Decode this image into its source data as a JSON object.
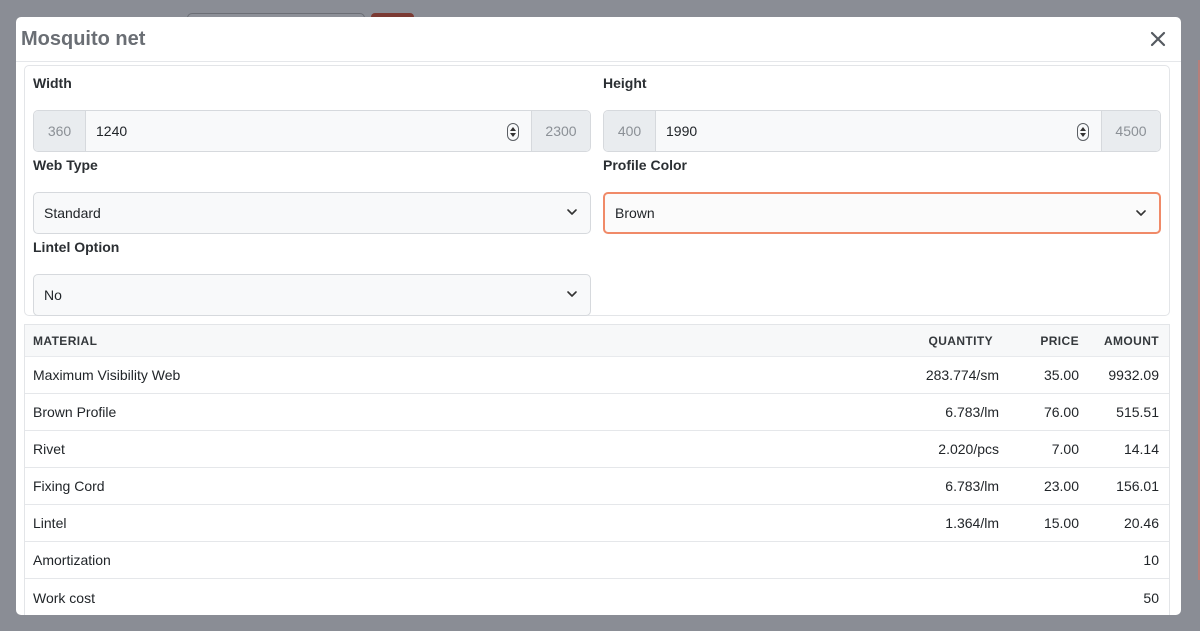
{
  "modal": {
    "title": "Mosquito net"
  },
  "form": {
    "width": {
      "label": "Width",
      "min": "360",
      "value": "1240",
      "max": "2300"
    },
    "height": {
      "label": "Height",
      "min": "400",
      "value": "1990",
      "max": "4500"
    },
    "web_type": {
      "label": "Web Type",
      "selected": "Standard"
    },
    "profile_color": {
      "label": "Profile Color",
      "selected": "Brown"
    },
    "lintel_option": {
      "label": "Lintel Option",
      "selected": "No"
    }
  },
  "table": {
    "headers": [
      "MATERIAL",
      "QUANTITY",
      "PRICE",
      "AMOUNT"
    ],
    "rows": [
      {
        "material": "Maximum Visibility Web",
        "quantity": "283.774/sm",
        "price": "35.00",
        "amount": "9932.09"
      },
      {
        "material": "Brown Profile",
        "quantity": "6.783/lm",
        "price": "76.00",
        "amount": "515.51"
      },
      {
        "material": "Rivet",
        "quantity": "2.020/pcs",
        "price": "7.00",
        "amount": "14.14"
      },
      {
        "material": "Fixing Cord",
        "quantity": "6.783/lm",
        "price": "23.00",
        "amount": "156.01"
      },
      {
        "material": "Lintel",
        "quantity": "1.364/lm",
        "price": "15.00",
        "amount": "20.46"
      },
      {
        "material": "Amortization",
        "quantity": "",
        "price": "",
        "amount": "10"
      },
      {
        "material": "Work cost",
        "quantity": "",
        "price": "",
        "amount": "50"
      }
    ]
  },
  "colors": {
    "focus_border": "#f08a68",
    "overlay": "#8a8d95"
  }
}
